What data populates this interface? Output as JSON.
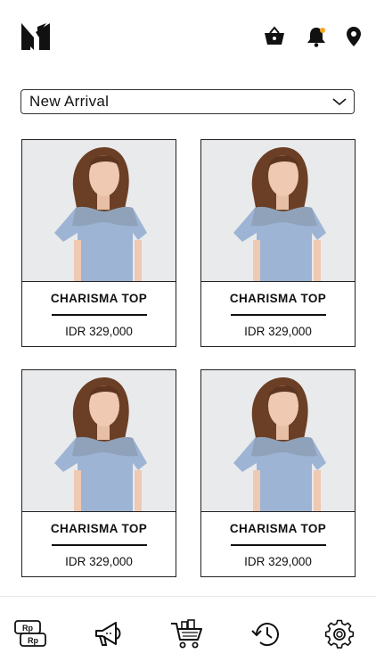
{
  "header": {
    "logo": "brand-logo-icon",
    "icons": [
      "basket-icon",
      "bell-icon",
      "location-pin-icon"
    ],
    "notification_dot_color": "#f5a623"
  },
  "filter": {
    "selected": "New Arrival"
  },
  "products": [
    {
      "name": "CHARISMA TOP",
      "price": "IDR 329,000"
    },
    {
      "name": "CHARISMA TOP",
      "price": "IDR 329,000"
    },
    {
      "name": "CHARISMA TOP",
      "price": "IDR 329,000"
    },
    {
      "name": "CHARISMA TOP",
      "price": "IDR 329,000"
    }
  ],
  "bottom_nav": {
    "rp_top": "Rp",
    "rp_bottom": "Rp",
    "items": [
      "currency-icon",
      "megaphone-icon",
      "cart-icon",
      "history-icon",
      "settings-icon"
    ]
  }
}
